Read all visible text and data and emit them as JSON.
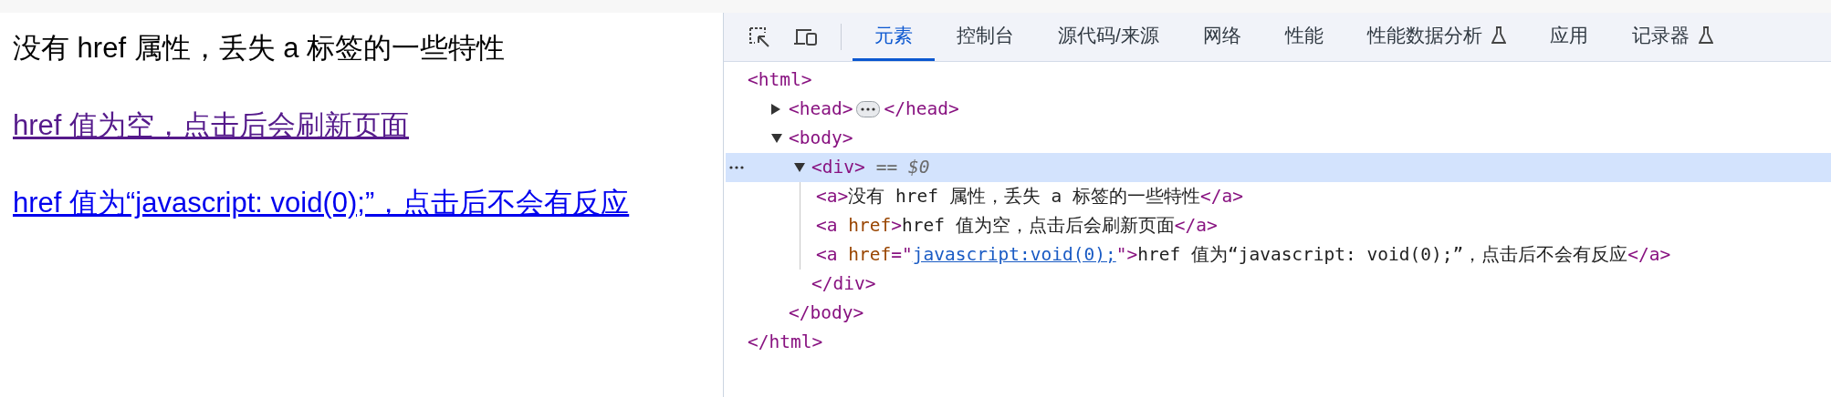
{
  "page": {
    "lines": [
      {
        "kind": "plain",
        "text": "没有 href 属性，丢失 a 标签的一些特性"
      },
      {
        "kind": "link",
        "visited": true,
        "text": "href 值为空，点击后会刷新页面"
      },
      {
        "kind": "link",
        "visited": false,
        "text": "href 值为“javascript: void(0);”，点击后不会有反应"
      }
    ]
  },
  "devtools": {
    "tabs": [
      {
        "label": "元素",
        "selected": true,
        "experimental": false
      },
      {
        "label": "控制台",
        "selected": false,
        "experimental": false
      },
      {
        "label": "源代码/来源",
        "selected": false,
        "experimental": false
      },
      {
        "label": "网络",
        "selected": false,
        "experimental": false
      },
      {
        "label": "性能",
        "selected": false,
        "experimental": false
      },
      {
        "label": "性能数据分析",
        "selected": false,
        "experimental": true
      },
      {
        "label": "应用",
        "selected": false,
        "experimental": false
      },
      {
        "label": "记录器",
        "selected": false,
        "experimental": true
      }
    ],
    "tree": [
      {
        "selected": false,
        "parts": [
          {
            "kind": "tag",
            "text": "<html>"
          }
        ],
        "close": [
          {
            "kind": "tag",
            "text": "</html>"
          }
        ],
        "children": [
          {
            "selected": false,
            "expanded": false,
            "parts": [
              {
                "kind": "tag",
                "text": "<head>"
              },
              {
                "kind": "ellipsis"
              },
              {
                "kind": "tag",
                "text": "</head>"
              }
            ]
          },
          {
            "selected": false,
            "expanded": true,
            "parts": [
              {
                "kind": "tag",
                "text": "<body>"
              }
            ],
            "close": [
              {
                "kind": "tag",
                "text": "</body>"
              }
            ],
            "children": [
              {
                "selected": true,
                "expanded": true,
                "parts": [
                  {
                    "kind": "tag",
                    "text": "<div>"
                  },
                  {
                    "kind": "marker",
                    "text": "== *$0*"
                  }
                ],
                "close": [
                  {
                    "kind": "tag",
                    "text": "</div>"
                  }
                ],
                "children": [
                  {
                    "selected": false,
                    "parts": [
                      {
                        "kind": "tag",
                        "text": "<a>"
                      },
                      {
                        "kind": "text",
                        "text": "没有 href 属性，丢失 a 标签的一些特性"
                      },
                      {
                        "kind": "tag",
                        "text": "</a>"
                      }
                    ]
                  },
                  {
                    "selected": false,
                    "parts": [
                      {
                        "kind": "tag",
                        "text": "<a "
                      },
                      {
                        "kind": "attr",
                        "text": "href"
                      },
                      {
                        "kind": "tag",
                        "text": ">"
                      },
                      {
                        "kind": "text",
                        "text": "href 值为空，点击后会刷新页面"
                      },
                      {
                        "kind": "tag",
                        "text": "</a>"
                      }
                    ]
                  },
                  {
                    "selected": false,
                    "parts": [
                      {
                        "kind": "tag",
                        "text": "<a "
                      },
                      {
                        "kind": "attr",
                        "text": "href"
                      },
                      {
                        "kind": "tag",
                        "text": "=\""
                      },
                      {
                        "kind": "value",
                        "text": "javascript:void(0);"
                      },
                      {
                        "kind": "tag",
                        "text": "\">"
                      },
                      {
                        "kind": "text",
                        "text": "href 值为“javascript: void(0);”，点击后不会有反应"
                      },
                      {
                        "kind": "tag",
                        "text": "</a>"
                      }
                    ]
                  }
                ]
              }
            ]
          }
        ]
      }
    ]
  }
}
